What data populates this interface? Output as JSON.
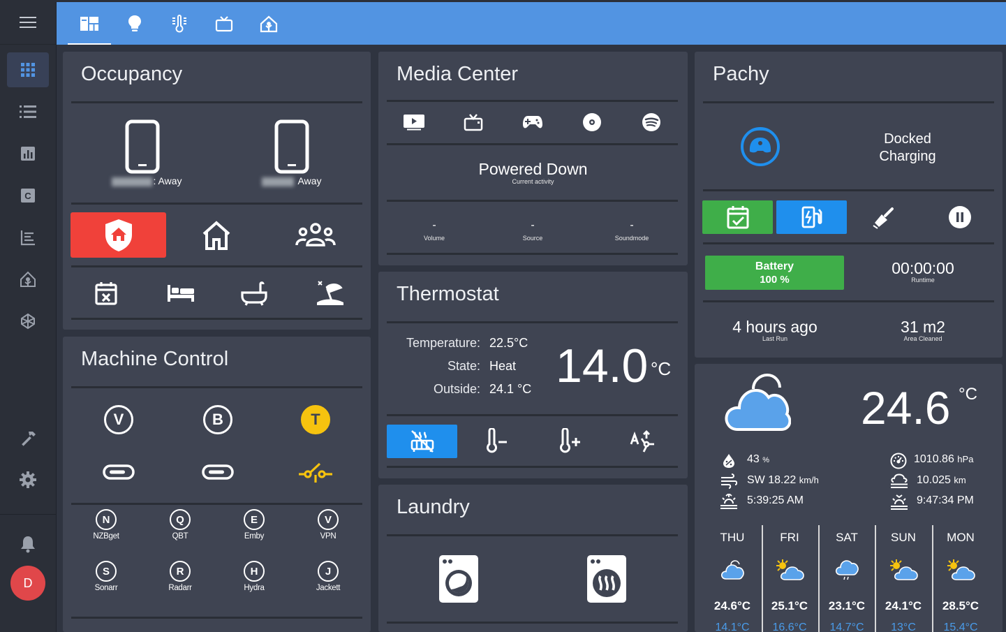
{
  "sidebar": {
    "menu_icon": "menu-icon",
    "items": [
      "grid-icon",
      "list-icon",
      "chart-icon",
      "calendar-icon",
      "logbook-icon",
      "home-assistant-icon",
      "node-red-icon"
    ],
    "bottom": [
      "hammer-icon",
      "gear-icon",
      "bell-icon"
    ],
    "avatar_letter": "D",
    "avatar_color": "#e0474a"
  },
  "topbar": {
    "color": "#5294e2",
    "tabs": [
      "dashboard-icon",
      "lightbulb-icon",
      "thermometer-icon",
      "tv-icon",
      "home-icon"
    ]
  },
  "occupancy": {
    "title": "Occupancy",
    "person1_status": ": Away",
    "person2_status": " Away"
  },
  "machine": {
    "title": "Machine Control",
    "letters": [
      "V",
      "B",
      "T"
    ],
    "services": [
      {
        "letter": "N",
        "label": "NZBget"
      },
      {
        "letter": "Q",
        "label": "QBT"
      },
      {
        "letter": "E",
        "label": "Emby"
      },
      {
        "letter": "V",
        "label": "VPN"
      },
      {
        "letter": "S",
        "label": "Sonarr"
      },
      {
        "letter": "R",
        "label": "Radarr"
      },
      {
        "letter": "H",
        "label": "Hydra"
      },
      {
        "letter": "J",
        "label": "Jackett"
      }
    ]
  },
  "media": {
    "title": "Media Center",
    "status": "Powered Down",
    "status_sub": "Current activity",
    "volume_val": "-",
    "volume_label": "Volume",
    "source_val": "-",
    "source_label": "Source",
    "sound_val": "-",
    "sound_label": "Soundmode"
  },
  "thermostat": {
    "title": "Thermostat",
    "temp_label": "Temperature:",
    "temp_val": "22.5°C",
    "state_label": "State:",
    "state_val": "Heat",
    "outside_label": "Outside:",
    "outside_val": "24.1 °C",
    "setpoint": "14.0",
    "unit": "°C"
  },
  "laundry": {
    "title": "Laundry"
  },
  "pachy": {
    "title": "Pachy",
    "status1": "Docked",
    "status2": "Charging",
    "battery_label": "Battery",
    "battery_val": "100 %",
    "runtime": "00:00:00",
    "runtime_label": "Runtime",
    "last_run": "4 hours ago",
    "last_run_label": "Last Run",
    "area": "31 m2",
    "area_label": "Area Cleaned"
  },
  "weather": {
    "temp": "24.6",
    "unit": "°C",
    "humidity": "43",
    "humidity_unit": "%",
    "wind": "SW 18.22",
    "wind_unit": "km/h",
    "sunrise": "5:39:25 AM",
    "pressure": "1010.86",
    "pressure_unit": "hPa",
    "visibility": "10.025",
    "visibility_unit": "km",
    "sunset": "9:47:34 PM",
    "forecast": [
      {
        "day": "THU",
        "high": "24.6°C",
        "low": "14.1°C",
        "icon": "cloud-icon"
      },
      {
        "day": "FRI",
        "high": "25.1°C",
        "low": "16.6°C",
        "icon": "partly-sunny-icon"
      },
      {
        "day": "SAT",
        "high": "23.1°C",
        "low": "14.7°C",
        "icon": "rain-icon"
      },
      {
        "day": "SUN",
        "high": "24.1°C",
        "low": "13°C",
        "icon": "partly-sunny-icon"
      },
      {
        "day": "MON",
        "high": "28.5°C",
        "low": "15.4°C",
        "icon": "partly-sunny-icon"
      }
    ]
  },
  "colors": {
    "card": "#3f4452",
    "red": "#f0413a",
    "green": "#3fae49",
    "blue": "#1f8fed",
    "amber": "#f6c30f",
    "cloud": "#5aa2ea",
    "low_temp": "#4a9be8"
  }
}
